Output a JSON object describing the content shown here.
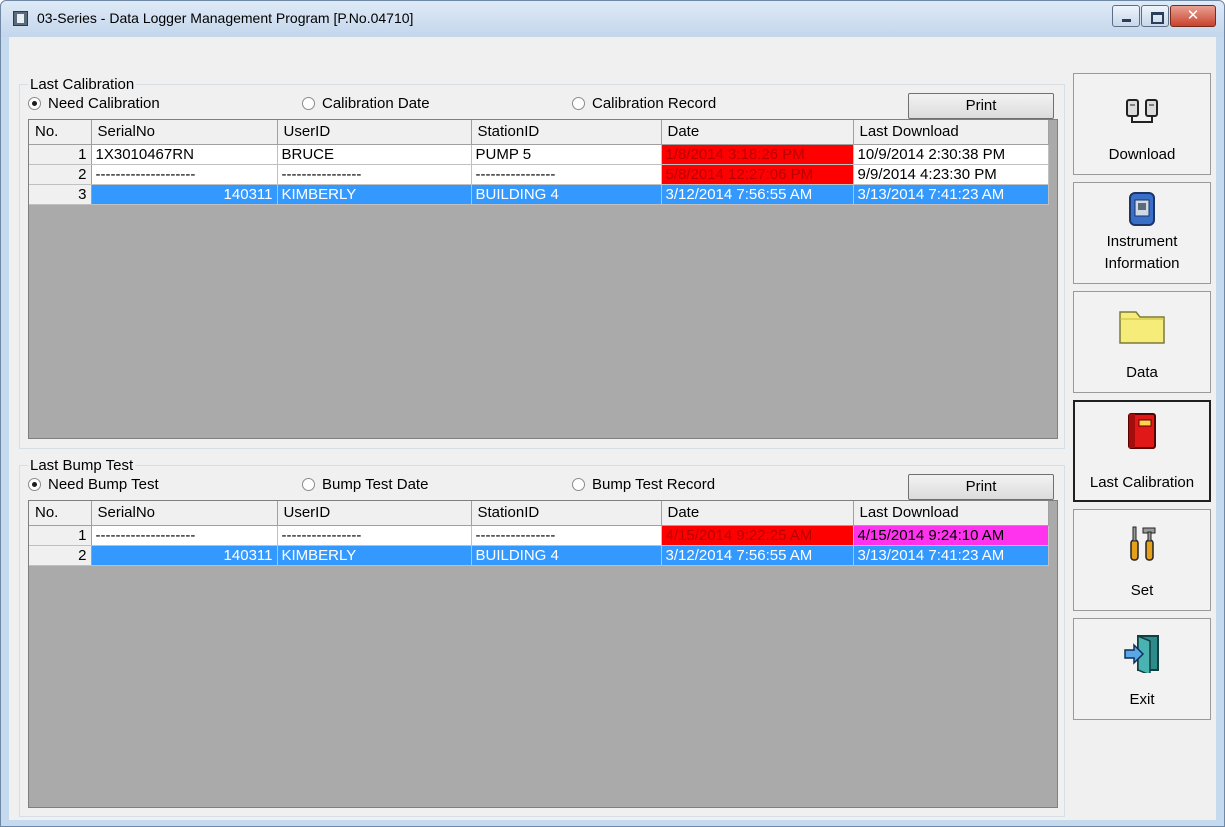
{
  "window": {
    "title": "03-Series  - Data Logger Management Program [P.No.04710]",
    "close_label": "✕"
  },
  "calibration": {
    "group_title": "Last Calibration",
    "options": [
      "Need Calibration",
      "Calibration Date",
      "Calibration Record"
    ],
    "selected_option": "Need Calibration",
    "print_label": "Print",
    "columns": [
      "No.",
      "SerialNo",
      "UserID",
      "StationID",
      "Date",
      "Last Download"
    ],
    "rows": [
      {
        "no": "1",
        "serial": "1X3010467RN",
        "user": "BRUCE",
        "station": "PUMP 5",
        "date": "1/8/2014 3:18:26 PM",
        "last_download": "10/9/2014 2:30:38 PM"
      },
      {
        "no": "2",
        "serial": "--------------------",
        "user": "----------------",
        "station": "----------------",
        "date": "5/8/2014 12:27:06 PM",
        "last_download": "9/9/2014 4:23:30 PM"
      },
      {
        "no": "3",
        "serial": "140311",
        "user": "KIMBERLY",
        "station": "BUILDING 4",
        "date": "3/12/2014 7:56:55 AM",
        "last_download": "3/13/2014 7:41:23 AM"
      }
    ]
  },
  "bump": {
    "group_title": "Last Bump Test",
    "options": [
      "Need Bump Test",
      "Bump Test Date",
      "Bump Test Record"
    ],
    "selected_option": "Need Bump Test",
    "print_label": "Print",
    "columns": [
      "No.",
      "SerialNo",
      "UserID",
      "StationID",
      "Date",
      "Last Download"
    ],
    "rows": [
      {
        "no": "1",
        "serial": "--------------------",
        "user": "----------------",
        "station": "----------------",
        "date": "4/15/2014 9:22:25 AM",
        "last_download": "4/15/2014 9:24:10 AM"
      },
      {
        "no": "2",
        "serial": "140311",
        "user": "KIMBERLY",
        "station": "BUILDING 4",
        "date": "3/12/2014 7:56:55 AM",
        "last_download": "3/13/2014 7:41:23 AM"
      }
    ]
  },
  "sidebar": {
    "download": "Download",
    "instrument_line1": "Instrument",
    "instrument_line2": "Information",
    "data": "Data",
    "last_calibration": "Last Calibration",
    "set": "Set",
    "exit": "Exit"
  },
  "colors": {
    "selection": "#3399ff",
    "overdue": "#ff0000",
    "warning": "#ff33ee",
    "grid_background": "#aaaaaa"
  }
}
